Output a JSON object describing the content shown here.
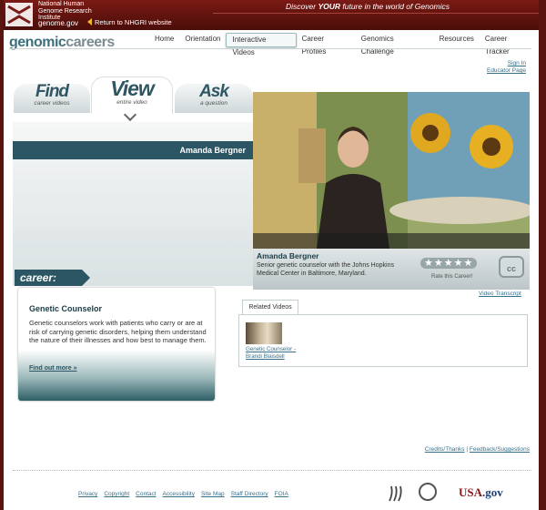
{
  "header": {
    "org_name": "National Human Genome Research Institute",
    "site": "genome.gov",
    "return_link": "Return to NHGRI website",
    "tagline_pre": "Discover",
    "tagline_em": "YOUR",
    "tagline_post": "future in the world of Genomics"
  },
  "logo": {
    "part1": "genomic",
    "part2": "careers"
  },
  "nav": {
    "items": [
      "Home",
      "Orientation",
      "Interactive Videos",
      "Career Profiles",
      "Genomics Challenge",
      "Resources",
      "Career Tracker"
    ],
    "active": "Interactive Videos"
  },
  "account": {
    "sign_in": "Sign In",
    "educator": "Educator Page"
  },
  "tabs": {
    "find": {
      "title": "Find",
      "sub": "career videos"
    },
    "view": {
      "title": "View",
      "sub": "entire video"
    },
    "ask": {
      "title": "Ask",
      "sub": "a question"
    }
  },
  "video": {
    "person_name": "Amanda Bergner",
    "caption_name": "Amanda Bergner",
    "description": "Senior genetic counselor with the Johns Hopkins Medical Center in Baltimore, Maryland.",
    "stars": "★★★★★",
    "rating": 0,
    "rate_label": "Rate this Career!",
    "cc_label": "cc",
    "transcript": "Video Transcript"
  },
  "career": {
    "tag": "career:",
    "title": "Genetic Counselor",
    "description": "Genetic counselors work with patients who carry or are at risk of carrying genetic disorders, helping them understand the nature of their illnesses and how best to manage them.",
    "find_out_more": "Find out more »"
  },
  "related": {
    "tab_label": "Related Videos",
    "items": [
      {
        "title": "Genetic Counselor - Brandi Blaisdell"
      }
    ]
  },
  "credits": {
    "credits_link": "Credits/Thanks",
    "feedback_link": "Feedback/Suggestions"
  },
  "footer": {
    "links": [
      "Privacy",
      "Copyright",
      "Contact",
      "Accessibility",
      "Site Map",
      "Staff Directory",
      "FOIA"
    ],
    "usagov_1": "USA",
    "usagov_2": ".gov"
  },
  "colors": {
    "banner": "#6b1611",
    "accent": "#2c5664",
    "link": "#38708a"
  }
}
